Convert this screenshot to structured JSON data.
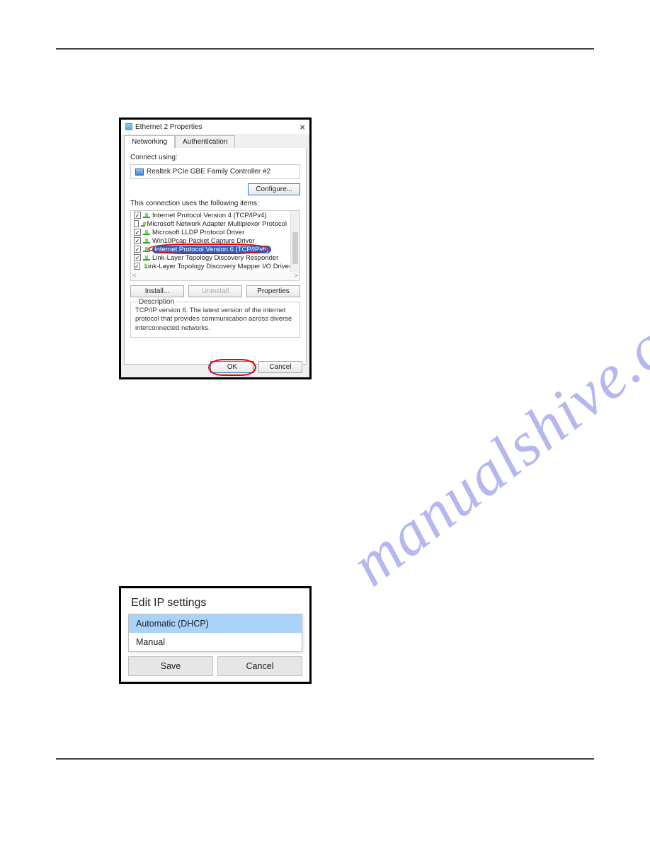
{
  "watermark": "manualshive.com",
  "ethDialog": {
    "title": "Ethernet 2 Properties",
    "tabs": {
      "networking": "Networking",
      "authentication": "Authentication"
    },
    "connectUsingLabel": "Connect using:",
    "adapterName": "Realtek PCIe GBE Family Controller #2",
    "configureBtn": "Configure...",
    "itemsLabel": "This connection uses the following items:",
    "items": [
      {
        "checked": true,
        "label": "Internet Protocol Version 4 (TCP/IPv4)"
      },
      {
        "checked": false,
        "label": "Microsoft Network Adapter Multiplexor Protocol"
      },
      {
        "checked": true,
        "label": "Microsoft LLDP Protocol Driver"
      },
      {
        "checked": true,
        "label": "Win10Pcap Packet Capture Driver"
      },
      {
        "checked": true,
        "label": "Internet Protocol Version 6 (TCP/IPv6)",
        "highlight": true
      },
      {
        "checked": true,
        "label": "Link-Layer Topology Discovery Responder"
      },
      {
        "checked": true,
        "label": "Link-Layer Topology Discovery Mapper I/O Driver"
      }
    ],
    "installBtn": "Install...",
    "uninstallBtn": "Uninstall",
    "propertiesBtn": "Properties",
    "descLegend": "Description",
    "descText": "TCP/IP version 6. The latest version of the internet protocol that provides communication across diverse interconnected networks.",
    "okBtn": "OK",
    "cancelBtn": "Cancel"
  },
  "ipDialog": {
    "title": "Edit IP settings",
    "options": {
      "auto": "Automatic (DHCP)",
      "manual": "Manual"
    },
    "saveBtn": "Save",
    "cancelBtn": "Cancel"
  }
}
